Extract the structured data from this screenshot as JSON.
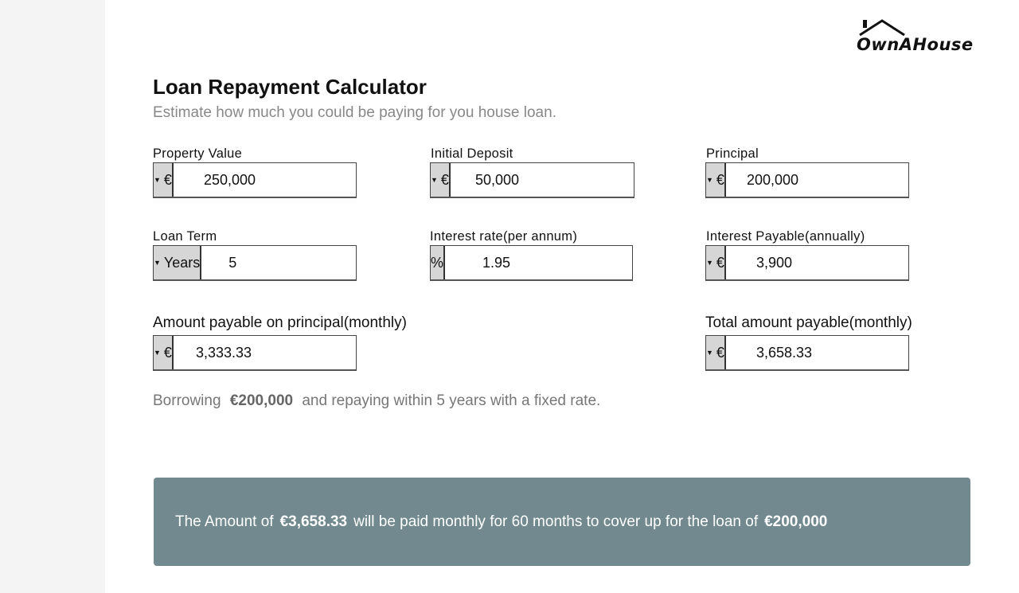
{
  "brand": {
    "logo_text": "OwnAHouse"
  },
  "header": {
    "title": "Loan Repayment Calculator",
    "subtitle": "Estimate how much you could be paying for you house loan."
  },
  "fields": {
    "property_value": {
      "label": "Property Value",
      "unit": "€",
      "value": "250,000"
    },
    "initial_deposit": {
      "label": "Initial Deposit",
      "unit": "€",
      "value": "50,000"
    },
    "principal": {
      "label": "Principal",
      "unit": "€",
      "value": "200,000"
    },
    "loan_term": {
      "label": "Loan Term",
      "unit": "Years",
      "value": "5"
    },
    "interest_rate": {
      "label": "Interest rate(per annum)",
      "unit": "%",
      "value": "1.95"
    },
    "interest_payable": {
      "label": "Interest Payable(annually)",
      "unit": "€",
      "value": "3,900"
    },
    "principal_monthly": {
      "label": "Amount payable on principal(monthly)",
      "unit": "€",
      "value": "3,333.33"
    },
    "total_monthly": {
      "label": "Total amount payable(monthly)",
      "unit": "€",
      "value": "3,658.33"
    }
  },
  "summary": {
    "prefix": "Borrowing",
    "amount": "€200,000",
    "suffix": "and repaying within 5 years with a fixed rate."
  },
  "banner": {
    "part1": "The Amount of",
    "monthly": "€3,658.33",
    "part2": "will be paid monthly for 60 months to cover up for the loan of",
    "loan": "€200,000",
    "color": "#728a8f"
  }
}
